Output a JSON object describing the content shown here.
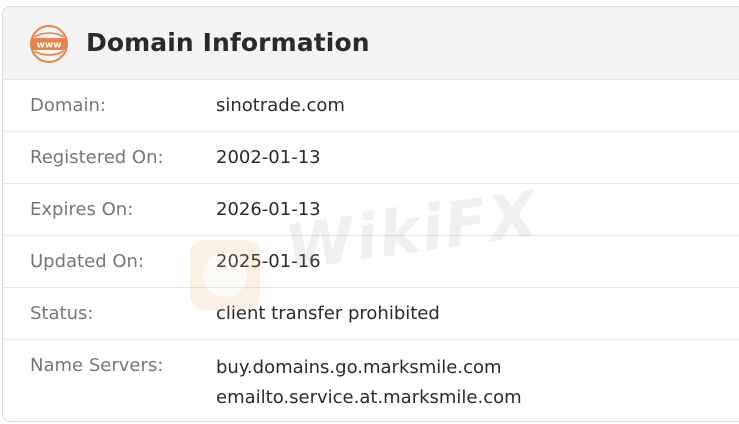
{
  "header": {
    "icon": "www-globe-icon",
    "icon_text": "www",
    "title": "Domain Information",
    "accent_color": "#e8834a"
  },
  "rows": [
    {
      "label": "Domain:",
      "value": "sinotrade.com"
    },
    {
      "label": "Registered On:",
      "value": "2002-01-13"
    },
    {
      "label": "Expires On:",
      "value": "2026-01-13"
    },
    {
      "label": "Updated On:",
      "value": "2025-01-16"
    },
    {
      "label": "Status:",
      "value": "client transfer prohibited"
    },
    {
      "label": "Name Servers:",
      "values": [
        "buy.domains.go.marksmile.com",
        "emailto.service.at.marksmile.com"
      ]
    }
  ],
  "watermark": {
    "text": "WikiFX"
  }
}
